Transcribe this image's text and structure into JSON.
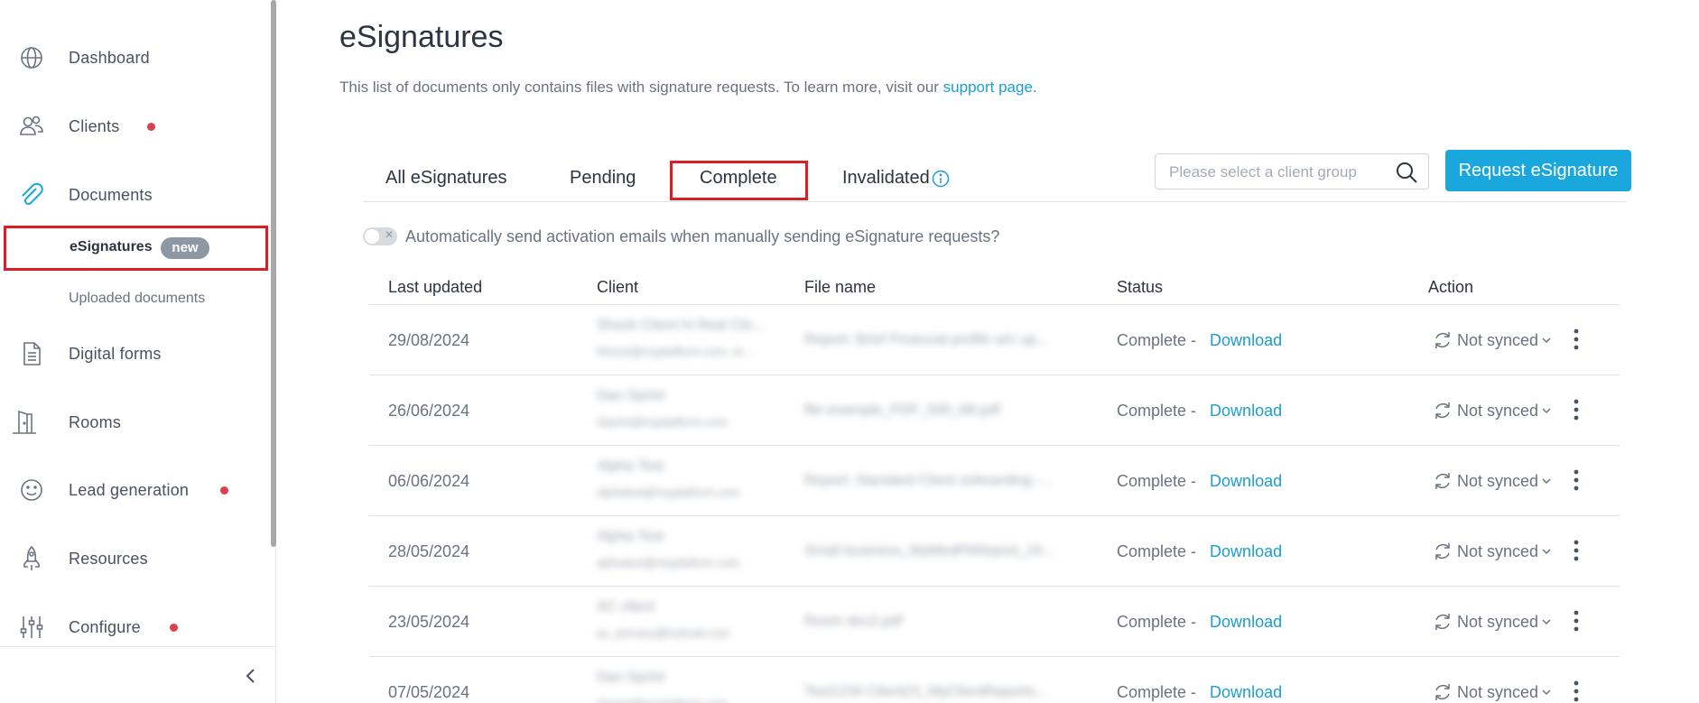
{
  "sidebar": {
    "items": [
      {
        "label": "Dashboard",
        "icon": "globe-icon"
      },
      {
        "label": "Clients",
        "icon": "users-icon",
        "dot": true
      },
      {
        "label": "Documents",
        "icon": "paperclip-icon"
      },
      {
        "label": "Digital forms",
        "icon": "document-icon"
      },
      {
        "label": "Rooms",
        "icon": "door-icon"
      },
      {
        "label": "Lead generation",
        "icon": "smiley-icon",
        "dot": true
      },
      {
        "label": "Resources",
        "icon": "rocket-icon"
      },
      {
        "label": "Configure",
        "icon": "sliders-icon",
        "dot": true
      }
    ],
    "sub_items": {
      "esignatures": "eSignatures",
      "esignatures_badge": "new",
      "uploaded": "Uploaded documents"
    }
  },
  "page": {
    "title": "eSignatures",
    "subtitle": "This list of documents only contains files with signature requests. To learn more, visit our ",
    "support_link": "support page",
    "subtitle_end": "."
  },
  "tabs": [
    "All eSignatures",
    "Pending",
    "Complete",
    "Invalidated"
  ],
  "search": {
    "placeholder": "Please select a client group"
  },
  "request_button": "Request eSignature",
  "toggle_label": "Automatically send activation emails when manually sending eSignature requests?",
  "table": {
    "headers": [
      "Last updated",
      "Client",
      "File name",
      "Status",
      "Action"
    ],
    "rows": [
      {
        "date": "29/08/2024",
        "client": "Shock Client hi Real Cle...",
        "email": "fshock@myplatform.com, re...",
        "file": "Report: Brief Financial profile w/c up...",
        "status": "Complete -",
        "link": "Download",
        "sync": "Not synced"
      },
      {
        "date": "26/06/2024",
        "client": "Dan Sprint",
        "email": "dsprint@myplatform.com",
        "file": "file-example_PDF_500_kB.pdf",
        "status": "Complete -",
        "link": "Download",
        "sync": "Not synced"
      },
      {
        "date": "06/06/2024",
        "client": "Alpha Test",
        "email": "alphatest@myplatform.com",
        "file": "Report: Standard Client onboarding -...",
        "status": "Complete -",
        "link": "Download",
        "sync": "Not synced"
      },
      {
        "date": "28/05/2024",
        "client": "Alpha Test",
        "email": "alphatest@myplatform.com",
        "file": "Small business_MyMedPAReport_24...",
        "status": "Complete -",
        "link": "Download",
        "sync": "Not synced"
      },
      {
        "date": "23/05/2024",
        "client": "AC client",
        "email": "ac_primary@hotmail.com",
        "file": "Room doc2.pdf",
        "status": "Complete -",
        "link": "Download",
        "sync": "Not synced"
      },
      {
        "date": "07/05/2024",
        "client": "Dan Sprint",
        "email": "dsprint@myplatform.com",
        "file": "Test1234 Client23_MyClientReports...",
        "status": "Complete -",
        "link": "Download",
        "sync": "Not synced"
      }
    ]
  },
  "colors": {
    "accent": "#1aa7dd",
    "link": "#1a9ed6",
    "highlight": "#d91e24",
    "dot": "#d9434f"
  }
}
